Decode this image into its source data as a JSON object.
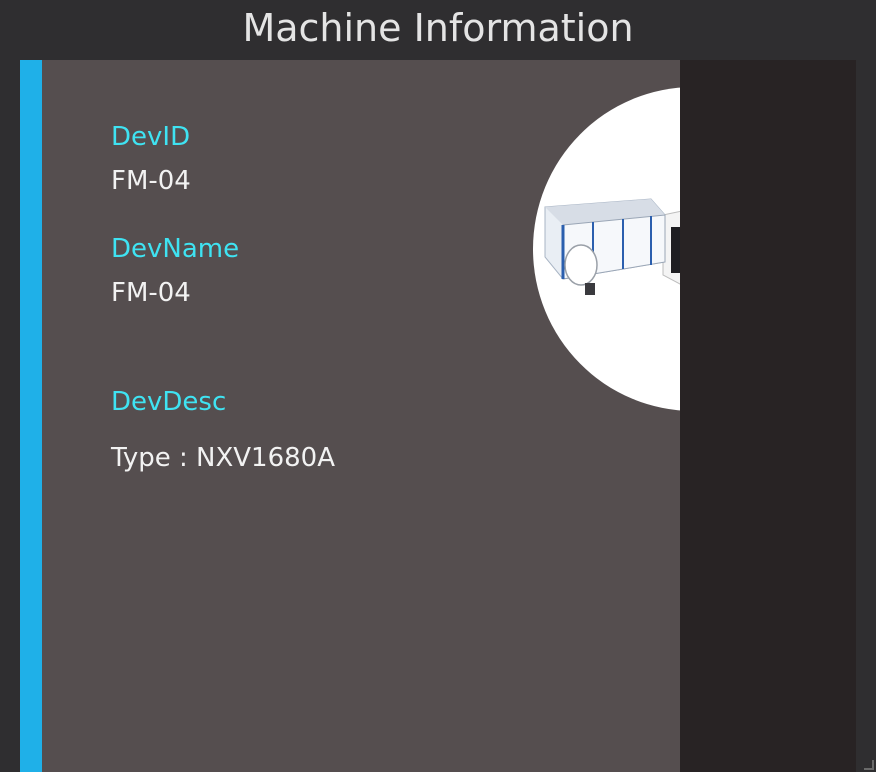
{
  "window": {
    "title": "Machine Information"
  },
  "machine": {
    "dev_id_label": "DevID",
    "dev_id_value": "FM-04",
    "dev_name_label": "DevName",
    "dev_name_value": "FM-04",
    "dev_desc_label": "DevDesc",
    "dev_desc_value": "Type : NXV1680A",
    "photo_icon": "machine-photo"
  },
  "colors": {
    "background": "#2f2e30",
    "accent": "#1fb0e8",
    "info_panel": "#554e4f",
    "side_panel": "#282324",
    "label_text": "#3fe3f2",
    "value_text": "#f2f2f2",
    "title_text": "#e4e4e4"
  }
}
